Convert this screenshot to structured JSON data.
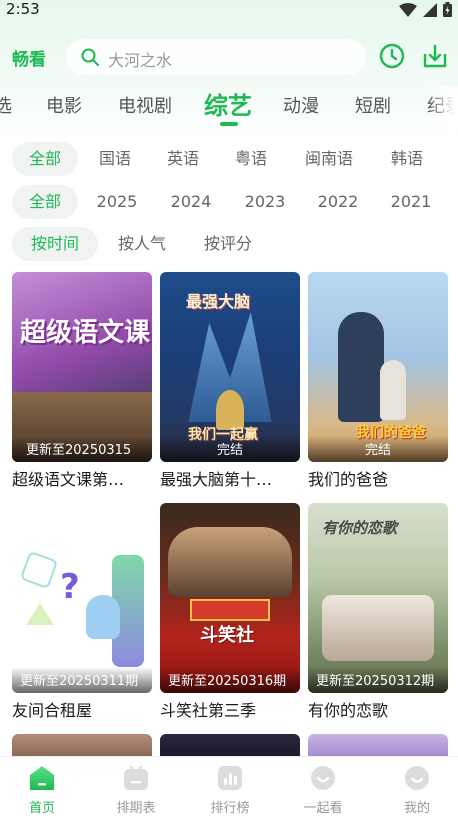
{
  "status": {
    "time": "2:53"
  },
  "header": {
    "brand": "畅看",
    "search_placeholder": "大河之水",
    "history_icon": "clock-icon",
    "download_icon": "download-icon"
  },
  "categories": [
    "选",
    "电影",
    "电视剧",
    "综艺",
    "动漫",
    "短剧",
    "纪录"
  ],
  "active_category": "综艺",
  "filters": {
    "language": [
      "全部",
      "国语",
      "英语",
      "粤语",
      "闽南语",
      "韩语"
    ],
    "year": [
      "全部",
      "2025",
      "2024",
      "2023",
      "2022",
      "2021"
    ],
    "sort": [
      "按时间",
      "按人气",
      "按评分"
    ]
  },
  "cards": [
    {
      "title": "超级语文课第…",
      "badge": "更新至20250315"
    },
    {
      "title": "最强大脑第十…",
      "badge": "完结"
    },
    {
      "title": "我们的爸爸",
      "badge": "完结"
    },
    {
      "title": "友间合租屋",
      "badge": "更新至20250311期"
    },
    {
      "title": "斗笑社第三季",
      "badge": "更新至20250316期"
    },
    {
      "title": "有你的恋歌",
      "badge": "更新至20250312期"
    }
  ],
  "poster_art": {
    "p1": "超级语文课",
    "p2": "最强大脑",
    "p2_sub": "我们一起赢",
    "p3": "我们的爸爸",
    "p5": "斗笑社",
    "p6": "有你的恋歌"
  },
  "bottom_nav": [
    {
      "label": "首页",
      "icon": "home-icon"
    },
    {
      "label": "排期表",
      "icon": "schedule-icon"
    },
    {
      "label": "排行榜",
      "icon": "ranking-icon"
    },
    {
      "label": "一起看",
      "icon": "watch-together-icon"
    },
    {
      "label": "我的",
      "icon": "profile-icon"
    }
  ],
  "colors": {
    "accent": "#1db954",
    "muted": "#999999"
  }
}
